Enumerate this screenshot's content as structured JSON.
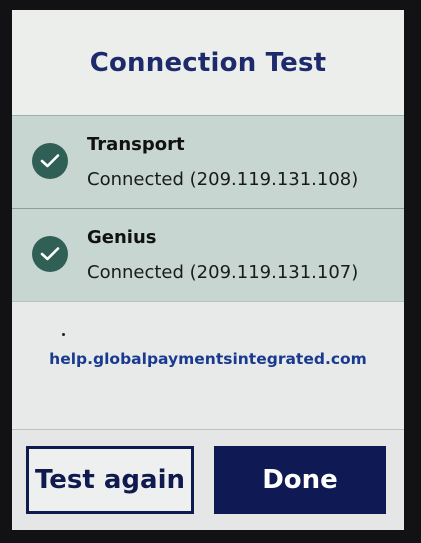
{
  "header": {
    "title": "Connection Test"
  },
  "checks": [
    {
      "name": "Transport",
      "status": "Connected (209.119.131.108)",
      "icon": "check-icon"
    },
    {
      "name": "Genius",
      "status": "Connected (209.119.131.107)",
      "icon": "check-icon"
    }
  ],
  "help": {
    "link": "help.globalpaymentsintegrated.com"
  },
  "footer": {
    "test_again_label": "Test again",
    "done_label": "Done"
  },
  "colors": {
    "title": "#1d2a6b",
    "row_background": "#c7d6d1",
    "check_badge": "#2f5f55",
    "link": "#1a3a8f",
    "primary_button": "#0f1a55"
  }
}
